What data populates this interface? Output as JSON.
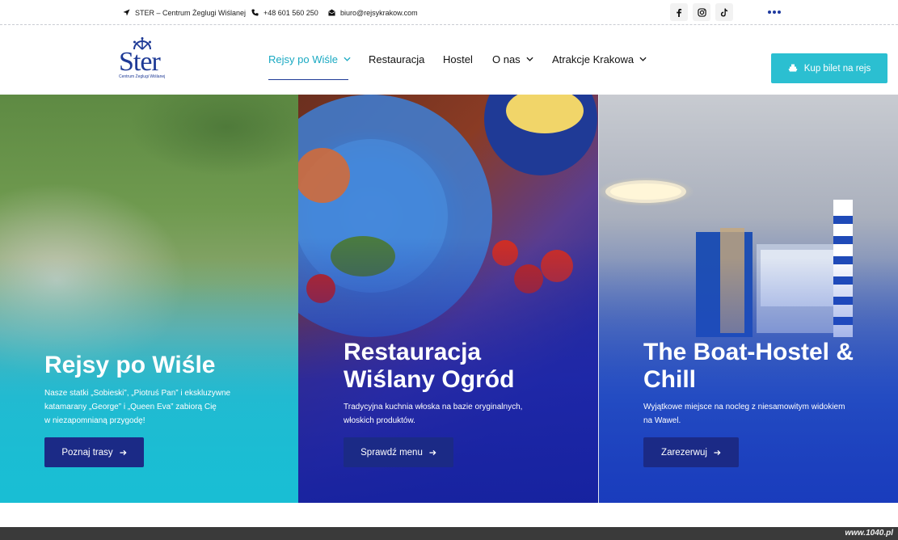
{
  "topbar": {
    "company": "STER – Centrum Żeglugi Wiślanej",
    "phone": "+48 601 560 250",
    "email": "biuro@rejsykrakow.com",
    "social": [
      "facebook-icon",
      "instagram-icon",
      "tiktok-icon"
    ]
  },
  "logo": {
    "word": "Ster",
    "subtitle": "Centrum Żeglugi Wiślanej"
  },
  "nav": {
    "items": [
      {
        "label": "Rejsy po Wiśle",
        "dropdown": true,
        "active": true
      },
      {
        "label": "Restauracja",
        "dropdown": false
      },
      {
        "label": "Hostel",
        "dropdown": false
      },
      {
        "label": "O nas",
        "dropdown": true
      },
      {
        "label": "Atrakcje Krakowa",
        "dropdown": true
      }
    ],
    "cta": "Kup bilet na rejs"
  },
  "panels": [
    {
      "title": "Rejsy po Wiśle",
      "desc1": "Nasze statki „Sobieski”, „Piotruś Pan” i ekskluzywne",
      "desc2": "katamarany „George” i „Queen Eva” zabiorą Cię",
      "desc3": "w niezapomnianą przygodę!",
      "button": "Poznaj trasy"
    },
    {
      "title1": "Restauracja",
      "title2": "Wiślany Ogród",
      "desc1": "Tradycyjna kuchnia włoska na bazie oryginalnych,",
      "desc2": "włoskich produktów.",
      "button": "Sprawdź menu"
    },
    {
      "title1": "The Boat-Hostel &",
      "title2": "Chill",
      "desc1": "Wyjątkowe miejsce na nocleg z niesamowitym widokiem",
      "desc2": "na Wawel.",
      "button": "Zarezerwuj"
    }
  ],
  "watermark": "www.1040.pl",
  "colors": {
    "accent": "#2bbfd1",
    "navy": "#1b2a86",
    "brand": "#1e3a96",
    "active_nav": "#19a9c2"
  }
}
